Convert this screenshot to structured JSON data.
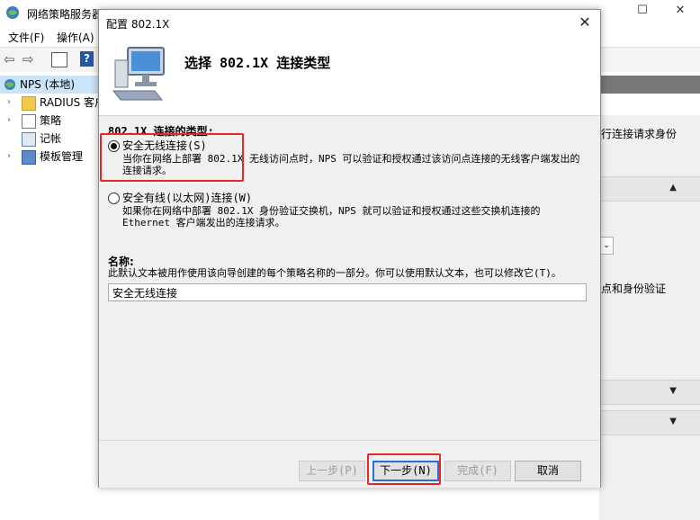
{
  "background_window": {
    "title": "网络策略服务器",
    "menu": [
      "文件(F)",
      "操作(A)"
    ],
    "tree": [
      {
        "label": "NPS (本地)"
      },
      {
        "label": "RADIUS 客户"
      },
      {
        "label": "策略"
      },
      {
        "label": "记帐"
      },
      {
        "label": "模板管理"
      }
    ],
    "right_text_1": "行连接请求身份",
    "right_text_2": "点和身份验证"
  },
  "dialog": {
    "title": "配置 802.1X",
    "heading": "选择 802.1X 连接类型",
    "section_label": "802.1X 连接的类型:",
    "options": [
      {
        "label": "安全无线连接(S)",
        "description": "当你在网络上部署 802.1X 无线访问点时，NPS 可以验证和授权通过该访问点连接的无线客户端发出的连接请求。",
        "selected": true
      },
      {
        "label": "安全有线(以太网)连接(W)",
        "description": "如果你在网络中部署 802.1X 身份验证交换机，NPS 就可以验证和授权通过这些交换机连接的 Ethernet 客户端发出的连接请求。",
        "selected": false
      }
    ],
    "name_label": "名称:",
    "name_help": "此默认文本被用作使用该向导创建的每个策略名称的一部分。你可以使用默认文本，也可以修改它(T)。",
    "name_value": "安全无线连接",
    "buttons": {
      "back": "上一步(P)",
      "next": "下一步(N)",
      "finish": "完成(F)",
      "cancel": "取消"
    }
  },
  "colors": {
    "highlight_box": "#e8262b",
    "dialog_body": "#f0f0f0",
    "right_header_bar": "#777777"
  }
}
